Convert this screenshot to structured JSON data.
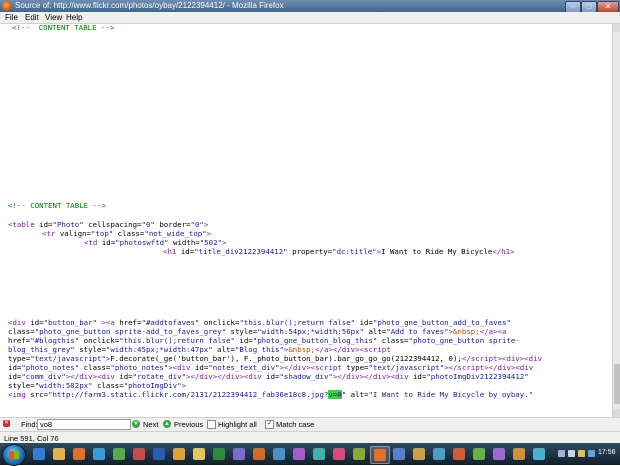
{
  "window": {
    "title": "Source of: http://www.flickr.com/photos/oybay/2122394412/ - Mozilla Firefox",
    "controls": [
      "–",
      "□",
      "✕"
    ]
  },
  "menu": [
    "File",
    "Edit",
    "View",
    "Help"
  ],
  "source": {
    "lines": [
      {
        "y": 0,
        "html": "<span class='cm'>&lt;!-- CONTENT TABLE --&gt;</span>"
      }
    ],
    "top_fragment": "&lt;!-- CONTENT TABLE --&gt;",
    "comment": "<!-- CONTENT TABLE -->",
    "table_line": "<table id=\"Photo\" cellspacing=\"0\" border=\"0\">",
    "tr_line": "<tr valign=\"top\" class=\"not_wide_top\">",
    "td_line": "<td id=\"photoswftd\" width=\"502\">",
    "h1_line": "<h1 id=\"title_div2122394412\" property=\"dc:title\">I Want to Ride My Bicycle</h1>"
  },
  "find": {
    "label": "Find:",
    "value": "vo8",
    "next": "Next",
    "previous": "Previous",
    "highlight_all": "Highlight all",
    "highlight_all_checked": false,
    "match_case": "Match case",
    "match_case_checked": true
  },
  "status": "Line 591, Col 76",
  "taskbar": {
    "clock": "17:56",
    "icons": [
      "ie-icon",
      "explorer-icon",
      "firefox-icon",
      "media-icon",
      "chat-icon",
      "app-icon",
      "word-icon",
      "paint-icon",
      "folder-icon",
      "excel-icon",
      "app2-icon",
      "app3-icon",
      "app4-icon",
      "app5-icon",
      "app6-icon",
      "app7-icon",
      "app8-icon",
      "firefox-active-icon",
      "app9-icon",
      "app10-icon",
      "app11-icon",
      "app12-icon",
      "app13-icon",
      "app14-icon",
      "app15-icon",
      "app16-icon"
    ]
  }
}
